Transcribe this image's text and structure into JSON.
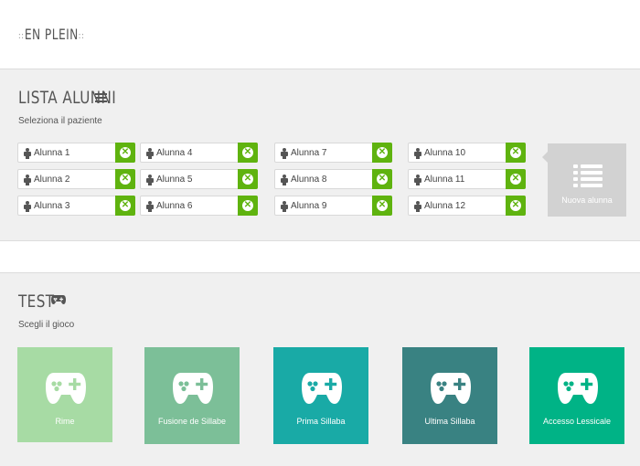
{
  "header": {
    "logo_text": "EN PLEIN",
    "logo_dots_left": "::",
    "logo_dots_right": "::"
  },
  "patients_section": {
    "title": "LISTA ALUNNI",
    "subtitle": "Seleziona il paziente",
    "icon": "list-icon",
    "patients": [
      "Alunna 1",
      "Alunna 2",
      "Alunna 3",
      "Alunna 4",
      "Alunna 5",
      "Alunna 6",
      "Alunna 7",
      "Alunna 8",
      "Alunna 9",
      "Alunna 10",
      "Alunna 11",
      "Alunna 12"
    ],
    "delete_icon": "delete-circle-icon",
    "delete_color": "#5fb30f",
    "new_button_label": "Nuova alunna"
  },
  "test_section": {
    "title": "TEST",
    "subtitle": "Scegli il gioco",
    "icon": "gamepad-icon",
    "games": [
      {
        "label": "Rime",
        "color": "#a7dba4"
      },
      {
        "label": "Fusione de Sillabe",
        "color": "#7cbf98"
      },
      {
        "label": "Prima Sillaba",
        "color": "#19aaa6"
      },
      {
        "label": "Ultima Sillaba",
        "color": "#398282"
      },
      {
        "label": "Accesso Lessicale",
        "color": "#00b386"
      }
    ]
  }
}
